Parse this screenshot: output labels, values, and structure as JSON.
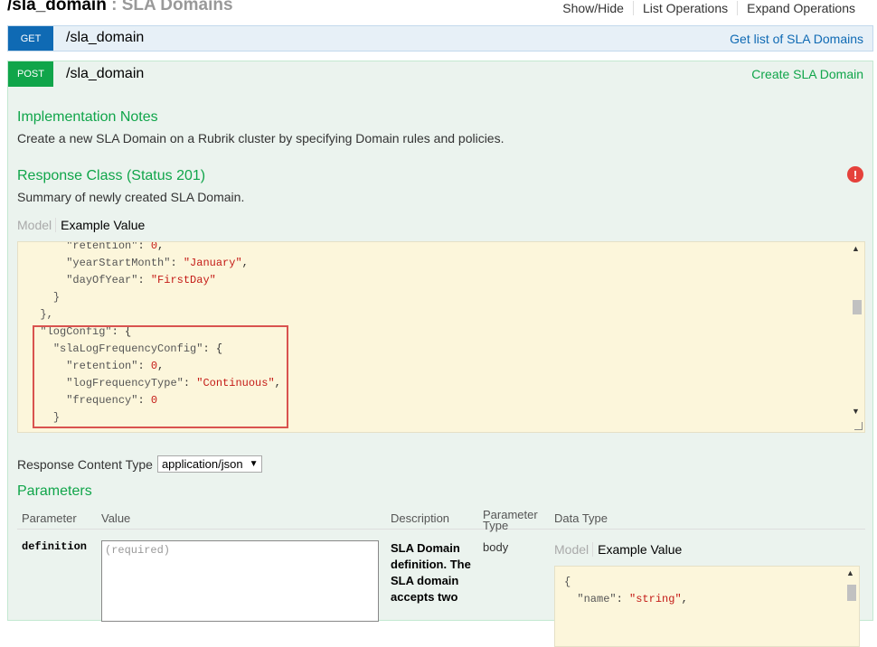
{
  "header": {
    "title": "/sla_domain",
    "separator": " : ",
    "subtitle": "SLA Domains",
    "links": [
      "Show/Hide",
      "List Operations",
      "Expand Operations"
    ]
  },
  "get_op": {
    "method": "GET",
    "path": "/sla_domain",
    "summary": "Get list of SLA Domains"
  },
  "post_op": {
    "method": "POST",
    "path": "/sla_domain",
    "summary": "Create SLA Domain",
    "impl_title": "Implementation Notes",
    "impl_text": "Create a new SLA Domain on a Rubrik cluster by specifying Domain rules and policies.",
    "resp_title": "Response Class (Status 201)",
    "resp_text": "Summary of newly created SLA Domain.",
    "error_icon": "!",
    "tab_model": "Model",
    "tab_example": "Example Value",
    "code_lines": [
      {
        "indent": "      ",
        "key": "\"retention\"",
        "sep": ": ",
        "val": "0",
        "tail": ","
      },
      {
        "indent": "      ",
        "key": "\"yearStartMonth\"",
        "sep": ": ",
        "val": "\"January\"",
        "tail": ","
      },
      {
        "indent": "      ",
        "key": "\"dayOfYear\"",
        "sep": ": ",
        "val": "\"FirstDay\"",
        "tail": ""
      },
      {
        "indent": "    ",
        "key": "}",
        "sep": "",
        "val": "",
        "tail": ""
      },
      {
        "indent": "  ",
        "key": "},",
        "sep": "",
        "val": "",
        "tail": ""
      },
      {
        "indent": "  ",
        "key": "\"logConfig\"",
        "sep": ": ",
        "val": "",
        "tail": "{"
      },
      {
        "indent": "    ",
        "key": "\"slaLogFrequencyConfig\"",
        "sep": ": ",
        "val": "",
        "tail": "{"
      },
      {
        "indent": "      ",
        "key": "\"retention\"",
        "sep": ": ",
        "val": "0",
        "tail": ","
      },
      {
        "indent": "      ",
        "key": "\"logFrequencyType\"",
        "sep": ": ",
        "val": "\"Continuous\"",
        "tail": ","
      },
      {
        "indent": "      ",
        "key": "\"frequency\"",
        "sep": ": ",
        "val": "0",
        "tail": ""
      },
      {
        "indent": "    ",
        "key": "}",
        "sep": "",
        "val": "",
        "tail": ""
      }
    ],
    "response_content_type_label": "Response Content Type",
    "response_content_type_value": "application/json",
    "parameters_title": "Parameters",
    "param_headers": {
      "parameter": "Parameter",
      "value": "Value",
      "description": "Description",
      "param_type": "Parameter Type",
      "data_type": "Data Type"
    },
    "param": {
      "name": "definition",
      "placeholder": "(required)",
      "description": "SLA Domain definition. The SLA domain accepts two",
      "type": "body",
      "tab_model": "Model",
      "tab_example": "Example Value",
      "example_lines": [
        {
          "indent": "",
          "key": "{",
          "sep": "",
          "val": "",
          "tail": ""
        },
        {
          "indent": "  ",
          "key": "\"name\"",
          "sep": ": ",
          "val": "\"string\"",
          "tail": ","
        }
      ]
    }
  }
}
